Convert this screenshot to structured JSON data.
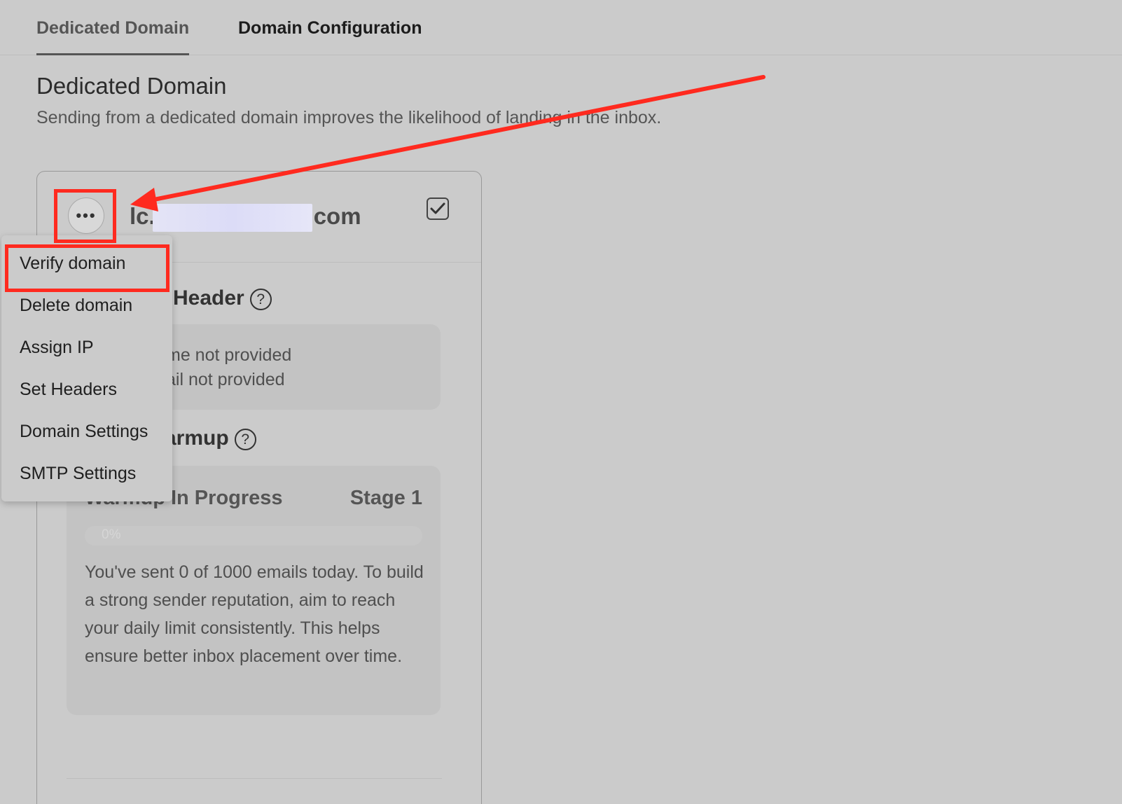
{
  "tabs": [
    {
      "label": "Dedicated Domain",
      "active": true
    },
    {
      "label": "Domain Configuration",
      "active": false
    }
  ],
  "page": {
    "title": "Dedicated Domain",
    "subtitle": "Sending from a dedicated domain improves the likelihood of landing in the inbox."
  },
  "card": {
    "domain_prefix": "lc.",
    "domain_suffix": "com",
    "header_section": {
      "title": "Header",
      "line1": "me not provided",
      "line2": "ail not provided"
    },
    "warmup_section": {
      "title": "armup",
      "status": "Warmup In Progress",
      "stage": "Stage 1",
      "progress_label": "0%",
      "progress_value": 0,
      "message": "You've sent 0 of 1000 emails today. To build a strong sender reputation, aim to reach your daily limit consistently. This helps ensure better inbox placement over time."
    }
  },
  "menu": {
    "items": [
      "Verify domain",
      "Delete domain",
      "Assign IP",
      "Set Headers",
      "Domain Settings",
      "SMTP Settings"
    ]
  },
  "icons": {
    "more": "ellipsis-icon",
    "checkbox": "checkbox-checked-icon",
    "help": "question-circle-icon"
  },
  "annotation_color": "#ff2a1f"
}
